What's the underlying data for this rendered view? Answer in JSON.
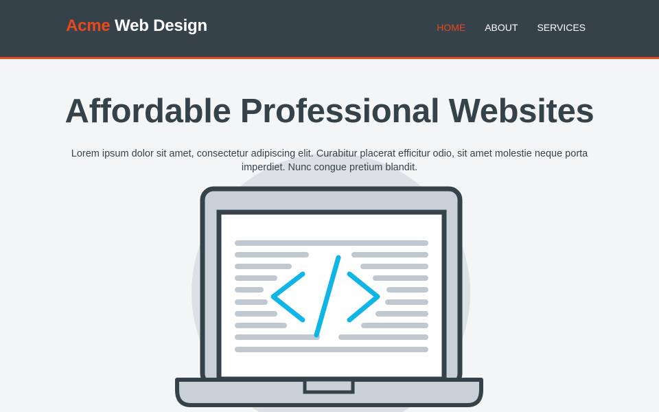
{
  "header": {
    "brand_highlight": "Acme",
    "brand_rest": " Web Design",
    "nav": [
      {
        "label": "HOME",
        "current": true
      },
      {
        "label": "ABOUT",
        "current": false
      },
      {
        "label": "SERVICES",
        "current": false
      }
    ]
  },
  "showcase": {
    "title": "Affordable Professional Websites",
    "text": "Lorem ipsum dolor sit amet, consectetur adipiscing elit. Curabitur placerat efficitur odio, sit amet molestie neque porta imperdiet. Nunc congue pretium blandit.",
    "illustration": "laptop-code-illustration"
  },
  "colors": {
    "header_bg": "#35424a",
    "accent": "#e8491d",
    "page_bg": "#f4f5f7",
    "code_icon": "#0fb5e6",
    "code_lines": "#c0c8d2",
    "circle": "#dde1e5",
    "laptop_outline": "#35424a",
    "laptop_body": "#c9d0d8"
  }
}
